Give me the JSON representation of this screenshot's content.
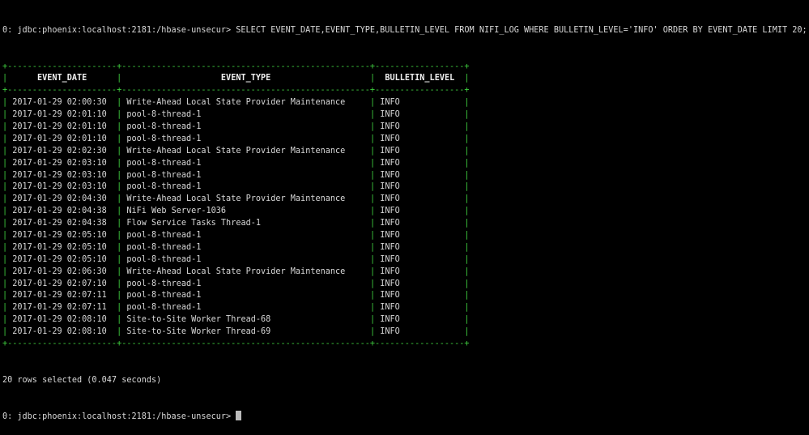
{
  "terminal": {
    "prompt": "0: jdbc:phoenix:localhost:2181:/hbase-unsecur>",
    "command": "SELECT EVENT_DATE,EVENT_TYPE,BULLETIN_LEVEL FROM NIFI_LOG WHERE BULLETIN_LEVEL='INFO' ORDER BY EVENT_DATE LIMIT 20;",
    "status": "20 rows selected (0.047 seconds)",
    "border_color": "#3fcf3f"
  },
  "table": {
    "headers": [
      "EVENT_DATE",
      "EVENT_TYPE",
      "BULLETIN_LEVEL"
    ],
    "rows": [
      [
        "2017-01-29 02:00:30",
        "Write-Ahead Local State Provider Maintenance",
        "INFO"
      ],
      [
        "2017-01-29 02:01:10",
        "pool-8-thread-1",
        "INFO"
      ],
      [
        "2017-01-29 02:01:10",
        "pool-8-thread-1",
        "INFO"
      ],
      [
        "2017-01-29 02:01:10",
        "pool-8-thread-1",
        "INFO"
      ],
      [
        "2017-01-29 02:02:30",
        "Write-Ahead Local State Provider Maintenance",
        "INFO"
      ],
      [
        "2017-01-29 02:03:10",
        "pool-8-thread-1",
        "INFO"
      ],
      [
        "2017-01-29 02:03:10",
        "pool-8-thread-1",
        "INFO"
      ],
      [
        "2017-01-29 02:03:10",
        "pool-8-thread-1",
        "INFO"
      ],
      [
        "2017-01-29 02:04:30",
        "Write-Ahead Local State Provider Maintenance",
        "INFO"
      ],
      [
        "2017-01-29 02:04:38",
        "NiFi Web Server-1036",
        "INFO"
      ],
      [
        "2017-01-29 02:04:38",
        "Flow Service Tasks Thread-1",
        "INFO"
      ],
      [
        "2017-01-29 02:05:10",
        "pool-8-thread-1",
        "INFO"
      ],
      [
        "2017-01-29 02:05:10",
        "pool-8-thread-1",
        "INFO"
      ],
      [
        "2017-01-29 02:05:10",
        "pool-8-thread-1",
        "INFO"
      ],
      [
        "2017-01-29 02:06:30",
        "Write-Ahead Local State Provider Maintenance",
        "INFO"
      ],
      [
        "2017-01-29 02:07:10",
        "pool-8-thread-1",
        "INFO"
      ],
      [
        "2017-01-29 02:07:11",
        "pool-8-thread-1",
        "INFO"
      ],
      [
        "2017-01-29 02:07:11",
        "pool-8-thread-1",
        "INFO"
      ],
      [
        "2017-01-29 02:08:10",
        "Site-to-Site Worker Thread-68",
        "INFO"
      ],
      [
        "2017-01-29 02:08:10",
        "Site-to-Site Worker Thread-69",
        "INFO"
      ]
    ]
  }
}
